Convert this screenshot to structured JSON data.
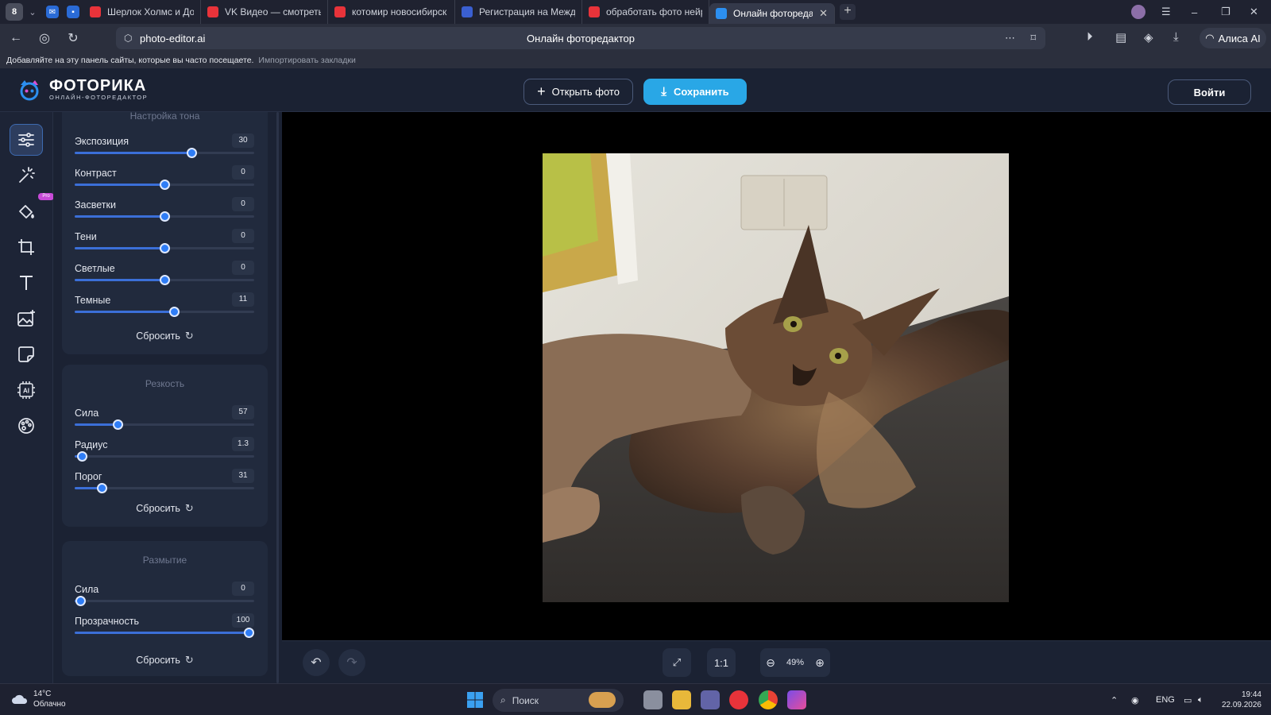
{
  "browser": {
    "profile_badge": "8",
    "tabs": [
      {
        "label": "Шерлок Холмс и Доктор",
        "favicon": "vk-video-icon"
      },
      {
        "label": "VK Видео — смотреть он",
        "favicon": "vk-video-icon"
      },
      {
        "label": "котомир новосибирск оф",
        "favicon": "yandex-icon"
      },
      {
        "label": "Регистрация на Междуна",
        "favicon": "site-icon"
      },
      {
        "label": "обработать фото нейрос",
        "favicon": "yandex-icon"
      },
      {
        "label": "Онлайн фоторедактор",
        "favicon": "fotorika-icon",
        "active": true
      }
    ],
    "address": {
      "domain": "photo-editor.ai",
      "page_title": "Онлайн фоторедактор"
    },
    "alisa_label": "Алиса AI",
    "bookmarks_hint": "Добавляйте на эту панель сайты, которые вы часто посещаете.",
    "bookmarks_import": "Импортировать закладки"
  },
  "app": {
    "logo_title": "ФОТОРИКА",
    "logo_subtitle": "ОНЛАЙН-ФОТОРЕДАКТОР",
    "open_button": "Открыть фото",
    "save_button": "Сохранить",
    "login_button": "Войти",
    "accent_color": "#29a7e6",
    "tools": [
      {
        "name": "adjust-sliders-icon",
        "active": true
      },
      {
        "name": "magic-wand-icon"
      },
      {
        "name": "paint-bucket-icon",
        "badge": "Pro"
      },
      {
        "name": "crop-icon"
      },
      {
        "name": "text-icon"
      },
      {
        "name": "image-add-icon"
      },
      {
        "name": "sticker-icon"
      },
      {
        "name": "ai-chip-icon"
      },
      {
        "name": "palette-icon"
      }
    ]
  },
  "panel": {
    "tone": {
      "title": "Настройка тона",
      "reset": "Сбросить",
      "sliders": [
        {
          "label": "Экспозиция",
          "value": "30",
          "pos": 0.65
        },
        {
          "label": "Контраст",
          "value": "0",
          "pos": 0.5
        },
        {
          "label": "Засветки",
          "value": "0",
          "pos": 0.5
        },
        {
          "label": "Тени",
          "value": "0",
          "pos": 0.5
        },
        {
          "label": "Светлые",
          "value": "0",
          "pos": 0.5
        },
        {
          "label": "Темные",
          "value": "11",
          "pos": 0.555
        }
      ]
    },
    "sharpness": {
      "title": "Резкость",
      "reset": "Сбросить",
      "sliders": [
        {
          "label": "Сила",
          "value": "57",
          "pos": 0.24
        },
        {
          "label": "Радиус",
          "value": "1.3",
          "pos": 0.04
        },
        {
          "label": "Порог",
          "value": "31",
          "pos": 0.15
        }
      ]
    },
    "blur": {
      "title": "Размытие",
      "reset": "Сбросить",
      "sliders": [
        {
          "label": "Сила",
          "value": "0",
          "pos": 0.03
        },
        {
          "label": "Прозрачность",
          "value": "100",
          "pos": 0.97
        }
      ]
    }
  },
  "canvas": {
    "fit_label": "1:1",
    "zoom_value": "49%"
  },
  "taskbar": {
    "temperature": "14°C",
    "condition": "Облачно",
    "search_label": "Поиск",
    "lang": "ENG",
    "time": "19:44",
    "date": "22.09.2026"
  }
}
